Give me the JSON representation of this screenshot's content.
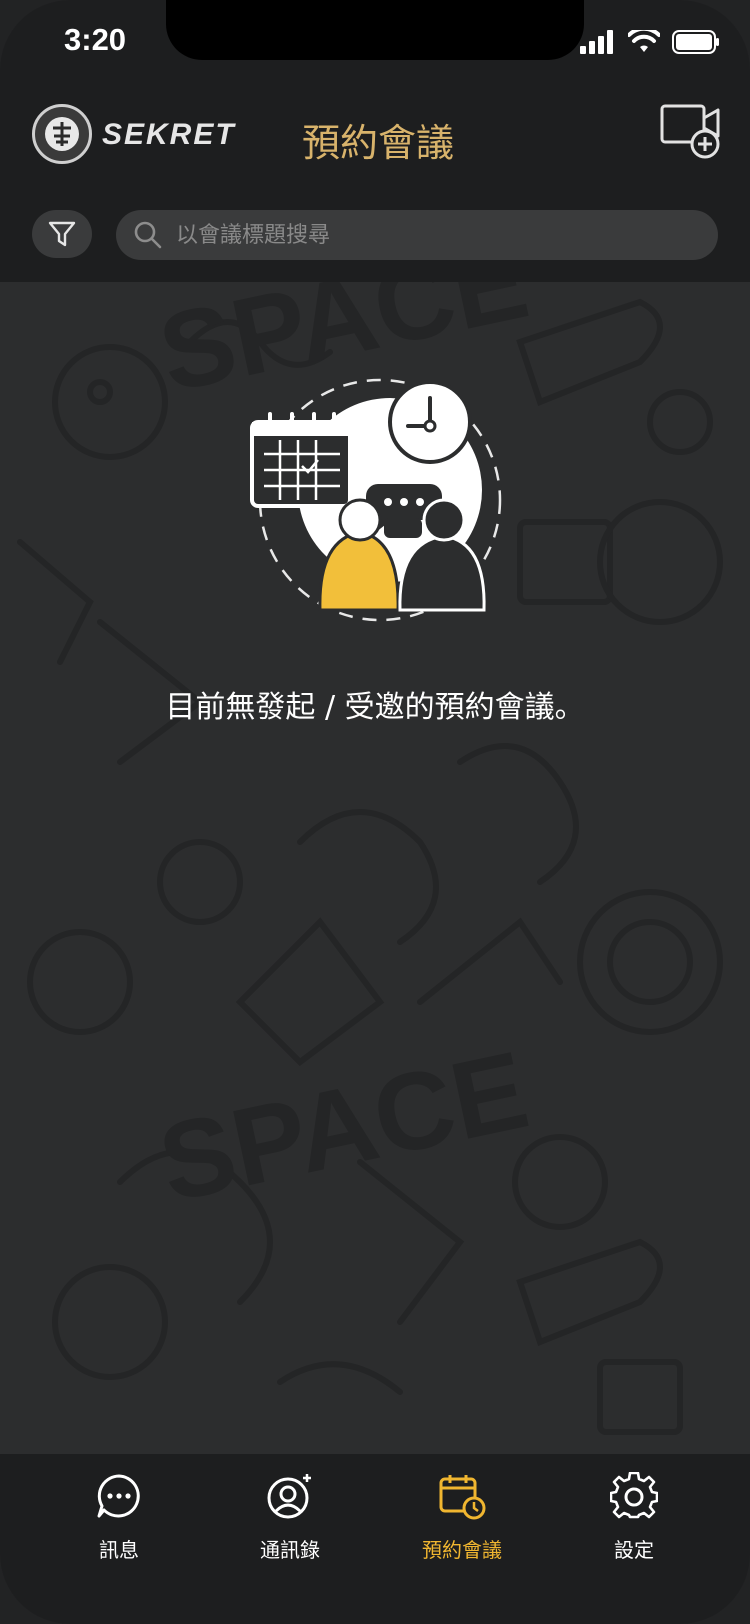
{
  "status_bar": {
    "time": "3:20"
  },
  "header": {
    "brand": "SEKRET",
    "title": "預約會議",
    "search_placeholder": "以會議標題搜尋"
  },
  "empty_state": {
    "message": "目前無發起 / 受邀的預約會議。"
  },
  "tabs": [
    {
      "label": "訊息",
      "icon": "chat-bubble-icon",
      "active": false
    },
    {
      "label": "通訊錄",
      "icon": "add-contact-icon",
      "active": false
    },
    {
      "label": "預約會議",
      "icon": "calendar-clock-icon",
      "active": true
    },
    {
      "label": "設定",
      "icon": "gear-icon",
      "active": false
    }
  ],
  "colors": {
    "accent": "#f0b630",
    "title": "#d8b36b",
    "background": "#2c2d2e",
    "bar": "#1d1e1f"
  }
}
